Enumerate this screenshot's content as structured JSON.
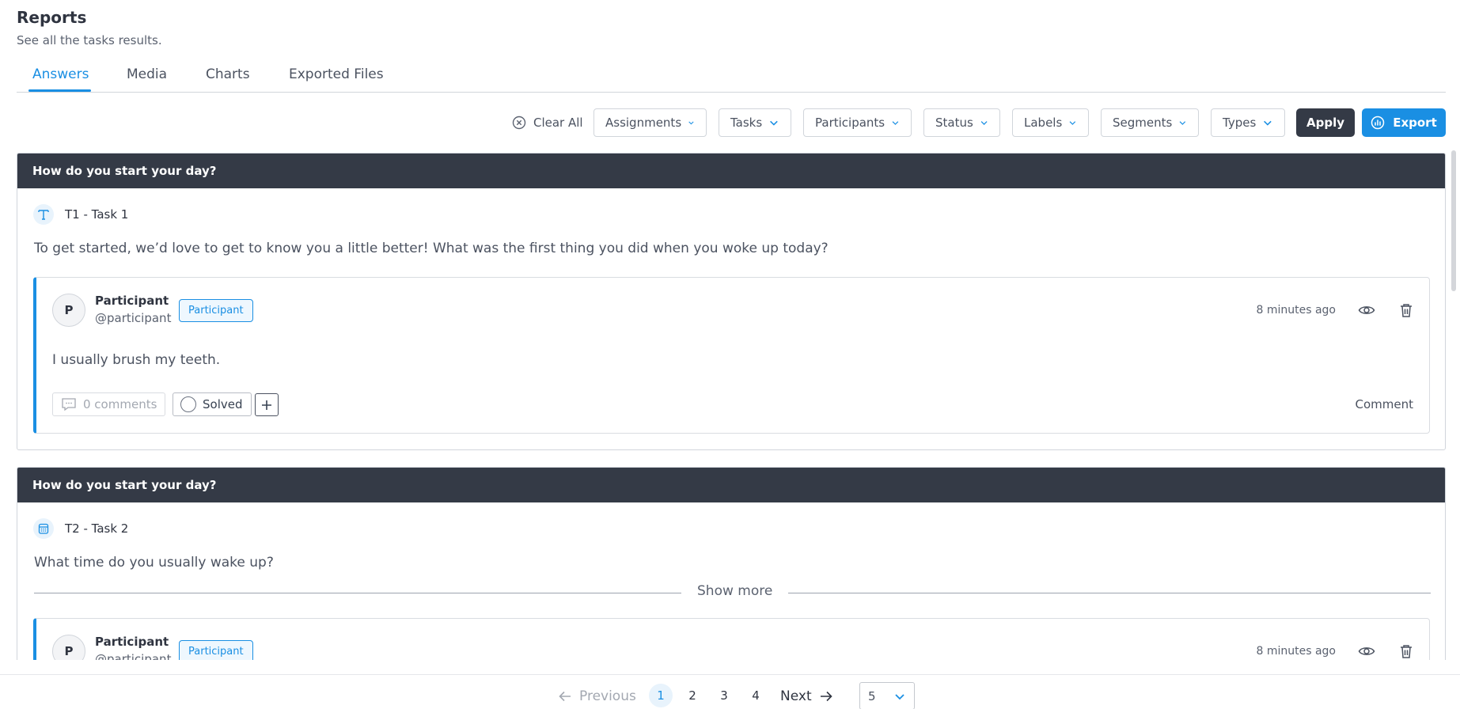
{
  "page": {
    "title": "Reports",
    "subtitle": "See all the tasks results."
  },
  "tabs": [
    {
      "label": "Answers",
      "active": true
    },
    {
      "label": "Media",
      "active": false
    },
    {
      "label": "Charts",
      "active": false
    },
    {
      "label": "Exported Files",
      "active": false
    }
  ],
  "filters": {
    "clear_all": "Clear All",
    "buttons": [
      "Assignments",
      "Tasks",
      "Participants",
      "Status",
      "Labels",
      "Segments",
      "Types"
    ],
    "apply": "Apply",
    "export": "Export"
  },
  "cards": [
    {
      "header": "How do you start your day?",
      "task_label": "T1 - Task 1",
      "task_icon": "text-icon",
      "question": "To get started, we’d love to get to know you a little better! What was the first thing you did when you woke up today?",
      "answer": {
        "avatar_initial": "P",
        "name": "Participant",
        "handle": "@participant",
        "role": "Participant",
        "time": "8 minutes ago",
        "text": "I usually brush my teeth.",
        "comments": "0 comments",
        "solved": "Solved",
        "comment_link": "Comment"
      }
    },
    {
      "header": "How do you start your day?",
      "task_label": "T2 - Task 2",
      "task_icon": "calendar-icon",
      "question": "What time do you usually wake up?",
      "show_more": "Show more",
      "answer": {
        "avatar_initial": "P",
        "name": "Participant",
        "handle": "@participant",
        "role": "Participant",
        "time": "8 minutes ago"
      }
    }
  ],
  "pagination": {
    "previous": "Previous",
    "pages": [
      "1",
      "2",
      "3",
      "4"
    ],
    "current": "1",
    "next": "Next",
    "page_size": "5"
  },
  "colors": {
    "accent": "#1a8fe3",
    "dark": "#343a46"
  }
}
